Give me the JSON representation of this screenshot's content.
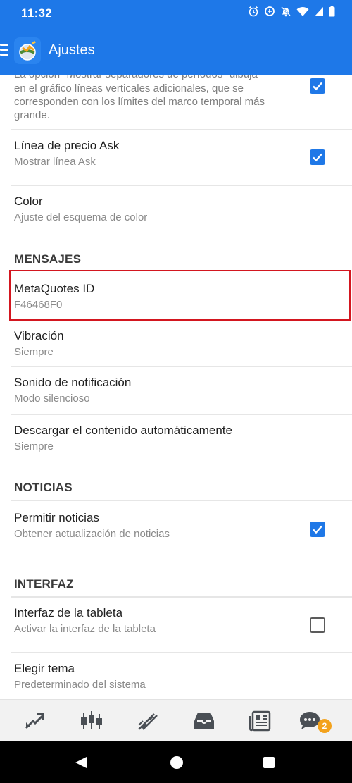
{
  "status_bar": {
    "time": "11:32"
  },
  "app_bar": {
    "title": "Ajustes"
  },
  "settings": {
    "separators_description": "La opción \"Mostrar separadores de períodos\" dibuja en el gráfico líneas verticales adicionales, que se corresponden con los límites del marco temporal más grande.",
    "separators_line1": "La opción \"Mostrar separadores de períodos\" dibuja",
    "separators_line2": "en el gráfico líneas verticales adicionales, que se",
    "separators_line3": "corresponden con los límites del marco temporal más",
    "separators_line4": "grande.",
    "ask_line": {
      "title": "Línea de precio Ask",
      "subtitle": "Mostrar línea Ask",
      "checked": true
    },
    "color": {
      "title": "Color",
      "subtitle": "Ajuste del esquema de color"
    },
    "section_messages": "MENSAJES",
    "metaquotes_id": {
      "title": "MetaQuotes ID",
      "value": "F46468F0"
    },
    "vibration": {
      "title": "Vibración",
      "value": "Siempre"
    },
    "notification_sound": {
      "title": "Sonido de notificación",
      "value": "Modo silencioso"
    },
    "auto_download": {
      "title": "Descargar el contenido automáticamente",
      "value": "Siempre"
    },
    "section_news": "NOTICIAS",
    "allow_news": {
      "title": "Permitir noticias",
      "subtitle": "Obtener actualización de noticias",
      "checked": true
    },
    "section_interface": "INTERFAZ",
    "tablet_interface": {
      "title": "Interfaz de la tableta",
      "subtitle": "Activar la interfaz de la tableta",
      "checked": false
    },
    "theme": {
      "title": "Elegir tema",
      "value": "Predeterminado del sistema"
    }
  },
  "bottom_nav": {
    "items": [
      "quotes-icon",
      "chart-icon",
      "trade-icon",
      "history-icon",
      "news-icon",
      "chat-icon"
    ],
    "chat_badge": "2"
  },
  "colors": {
    "primary": "#1e78e8",
    "checkbox": "#1f78e7",
    "highlight": "#d3161f",
    "badge": "#f3a21c"
  }
}
